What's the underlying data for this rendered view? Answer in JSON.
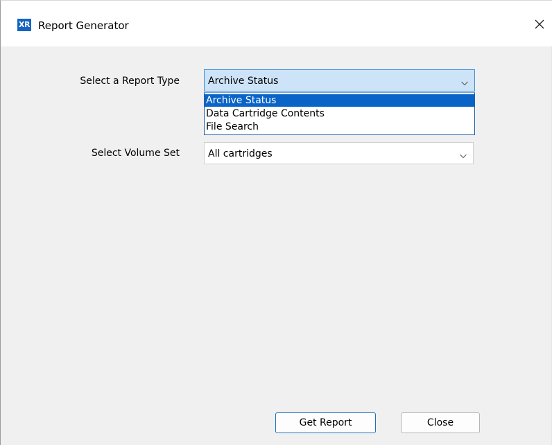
{
  "window": {
    "title": "Report Generator",
    "app_icon_text": "XR",
    "icons": {
      "app": "app-logo-icon",
      "close": "close-icon",
      "dropdown": "chevron-down-icon"
    }
  },
  "form": {
    "report_type": {
      "label": "Select a Report Type",
      "selected": "Archive Status",
      "options": [
        "Archive Status",
        "Data Cartridge Contents",
        "File Search"
      ],
      "highlighted_index": 0
    },
    "volume_set": {
      "label": "Select Volume Set",
      "selected": "All cartridges"
    }
  },
  "buttons": {
    "get_report": "Get Report",
    "close": "Close"
  },
  "colors": {
    "selection": "#0a64c8",
    "combo_focus_bg": "#cde3f7",
    "combo_focus_border": "#3c8fdb",
    "default_button_border": "#1f6fc0"
  }
}
